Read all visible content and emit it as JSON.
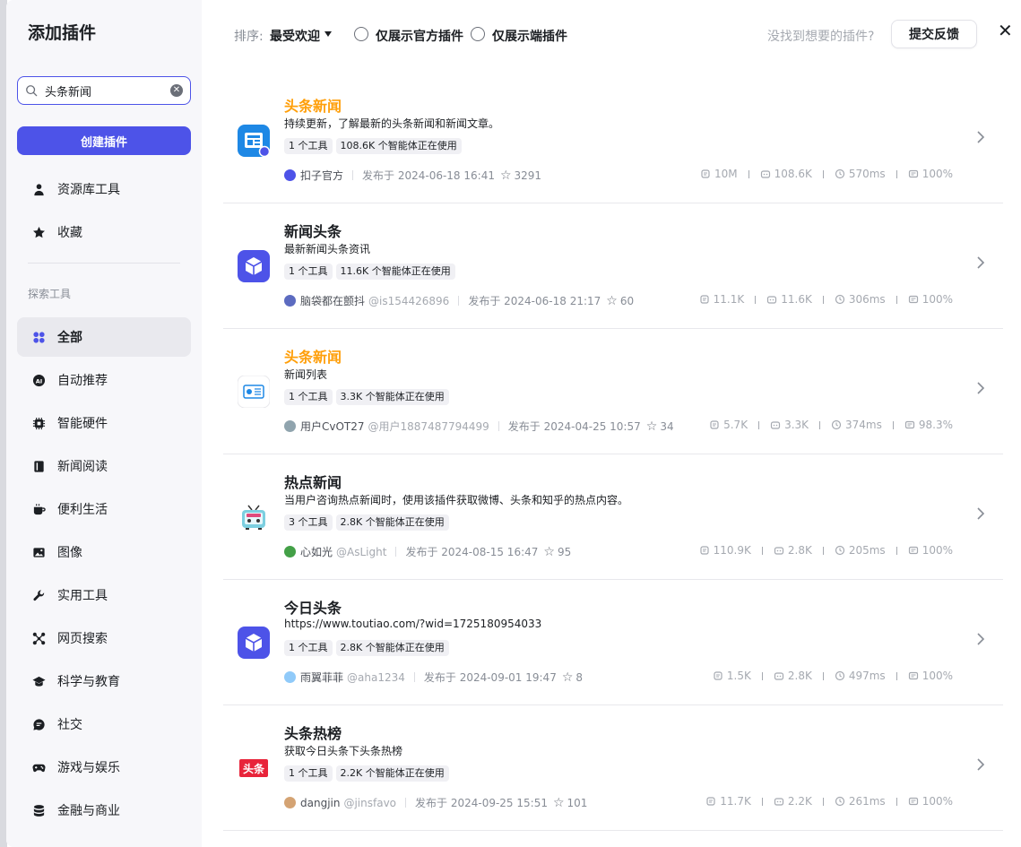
{
  "modal": {
    "title": "添加插件"
  },
  "search": {
    "value": "头条新闻"
  },
  "create_button": "创建插件",
  "sidebar_top": [
    {
      "label": "资源库工具",
      "icon": "person-icon"
    },
    {
      "label": "收藏",
      "icon": "star-icon"
    }
  ],
  "section_label": "探索工具",
  "categories": [
    {
      "label": "全部",
      "icon": "grid-icon",
      "active": true
    },
    {
      "label": "自动推荐",
      "icon": "ai-icon"
    },
    {
      "label": "智能硬件",
      "icon": "chip-icon"
    },
    {
      "label": "新闻阅读",
      "icon": "book-icon"
    },
    {
      "label": "便利生活",
      "icon": "cup-icon"
    },
    {
      "label": "图像",
      "icon": "image-icon"
    },
    {
      "label": "实用工具",
      "icon": "wrench-icon"
    },
    {
      "label": "网页搜索",
      "icon": "network-icon"
    },
    {
      "label": "科学与教育",
      "icon": "graduation-cap-icon"
    },
    {
      "label": "社交",
      "icon": "chat-icon"
    },
    {
      "label": "游戏与娱乐",
      "icon": "gamepad-icon"
    },
    {
      "label": "金融与商业",
      "icon": "database-icon"
    }
  ],
  "toolbar": {
    "sort_label": "排序:",
    "sort_value": "最受欢迎",
    "filter_official": "仅展示官方插件",
    "filter_device": "仅展示端插件",
    "hint": "没找到想要的插件?",
    "feedback": "提交反馈",
    "close": "✕"
  },
  "plugins": [
    {
      "name": "头条新闻",
      "highlight": true,
      "desc": "持续更新，了解最新的头条新闻和新闻文章。",
      "tools": "1 个工具",
      "usage": "108.6K 个智能体正在使用",
      "author": "扣子官方",
      "handle": "",
      "published": "发布于 2024-06-18 16:41",
      "stars": "3291",
      "calls": "10M",
      "bots": "108.6K",
      "latency": "570ms",
      "success": "100%",
      "logo": "news-doc"
    },
    {
      "name": "新闻头条",
      "highlight": false,
      "desc": "最新新闻头条资讯",
      "tools": "1 个工具",
      "usage": "11.6K 个智能体正在使用",
      "author": "脑袋都在颤抖",
      "handle": "@is154426896",
      "published": "发布于 2024-06-18 21:17",
      "stars": "60",
      "calls": "11.1K",
      "bots": "11.6K",
      "latency": "306ms",
      "success": "100%",
      "logo": "cube"
    },
    {
      "name": "头条新闻",
      "highlight": true,
      "desc": "新闻列表",
      "tools": "1 个工具",
      "usage": "3.3K 个智能体正在使用",
      "author": "用户CvOT27",
      "handle": "@用户1887487794499",
      "published": "发布于 2024-04-25 10:57",
      "stars": "34",
      "calls": "5.7K",
      "bots": "3.3K",
      "latency": "374ms",
      "success": "98.3%",
      "logo": "newspaper"
    },
    {
      "name": "热点新闻",
      "highlight": false,
      "desc": "当用户咨询热点新闻时，使用该插件获取微博、头条和知乎的热点内容。",
      "tools": "3 个工具",
      "usage": "2.8K 个智能体正在使用",
      "author": "心如光",
      "handle": "@AsLight",
      "published": "发布于 2024-08-15 16:47",
      "stars": "95",
      "calls": "110.9K",
      "bots": "2.8K",
      "latency": "205ms",
      "success": "100%",
      "logo": "tv"
    },
    {
      "name": "今日头条",
      "highlight": false,
      "desc": "https://www.toutiao.com/?wid=1725180954033",
      "tools": "1 个工具",
      "usage": "2.8K 个智能体正在使用",
      "author": "雨翼菲菲",
      "handle": "@aha1234",
      "published": "发布于 2024-09-01 19:47",
      "stars": "8",
      "calls": "1.5K",
      "bots": "2.8K",
      "latency": "497ms",
      "success": "100%",
      "logo": "cube"
    },
    {
      "name": "头条热榜",
      "highlight": false,
      "desc": "获取今日头条下头条热榜",
      "tools": "1 个工具",
      "usage": "2.2K 个智能体正在使用",
      "author": "dangjin",
      "handle": "@jinsfavo",
      "published": "发布于 2024-09-25 15:51",
      "stars": "101",
      "calls": "11.7K",
      "bots": "2.2K",
      "latency": "261ms",
      "success": "100%",
      "logo": "toutiao",
      "logo_text": "头条"
    }
  ]
}
